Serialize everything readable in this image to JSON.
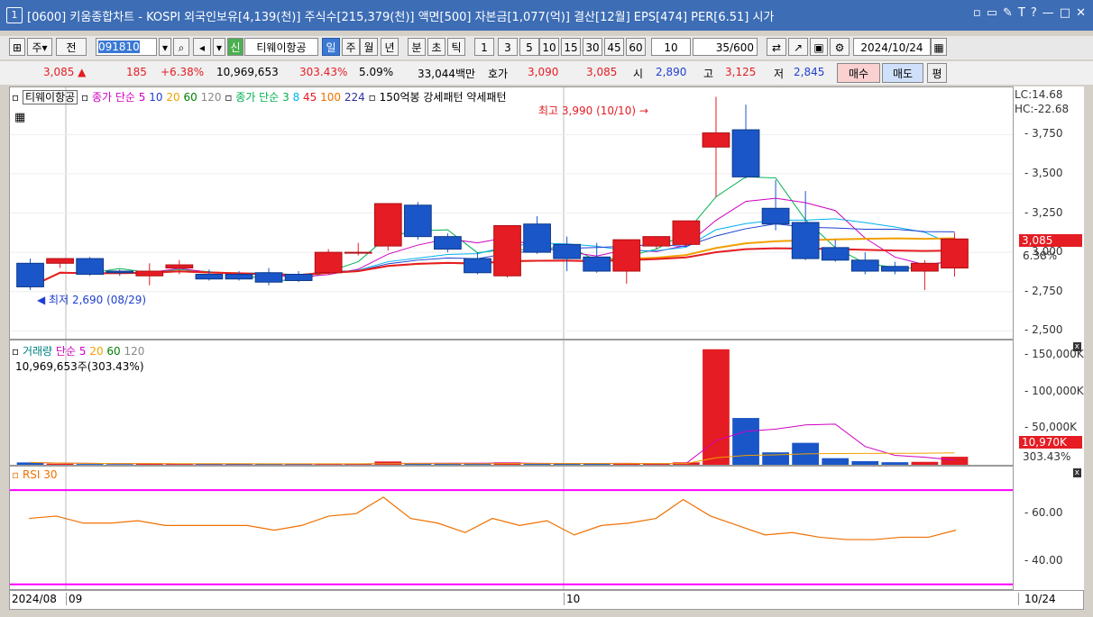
{
  "window": {
    "number": "1",
    "title": "[0600] 키움종합차트 - KOSPI 외국인보유[4,139(천)] 주식수[215,379(천)] 액면[500] 자본금[1,077(억)] 결산[12월] EPS[474] PER[6.51] 시가"
  },
  "toolbar": {
    "period_type": "주",
    "prev_label": "전",
    "code_value": "091810",
    "stock_name": "티웨이항공",
    "new_badge": "신",
    "tabs": [
      "일",
      "주",
      "월",
      "년",
      "분",
      "초",
      "틱"
    ],
    "selected_tab": "일",
    "interval_buttons": [
      "1",
      "3",
      "5",
      "10",
      "15",
      "30",
      "45",
      "60"
    ],
    "interval_value": "10",
    "count_value": "35",
    "count_total": "/600",
    "date_value": "2024/10/24"
  },
  "quote": {
    "price": "3,085",
    "change": "185",
    "change_pct": "+6.38%",
    "volume": "10,969,653",
    "volume_ratio": "303.43%",
    "turnover_pct": "5.09%",
    "amount": "33,044백만",
    "bid_label": "호가",
    "ask_price": "3,090",
    "bid_price": "3,085",
    "open_label": "시",
    "open": "2,890",
    "high_label": "고",
    "high": "3,125",
    "low_label": "저",
    "low": "2,845",
    "buy_label": "매수",
    "sell_label": "매도",
    "eval_label": "평"
  },
  "price_panel": {
    "legend_name": "티웨이항공",
    "legend_ma_label": "종가 단순",
    "legend_ma_periods": [
      "5",
      "10",
      "20",
      "60",
      "120"
    ],
    "legend_ma2_label": "종가 단순",
    "legend_ma2_periods": [
      "3",
      "8",
      "45",
      "100",
      "224"
    ],
    "legend_pattern": "150억봉 강세패턴  약세패턴",
    "lc": "LC:14.68",
    "hc": "HC:-22.68",
    "high_annotation": "최고 3,990 (10/10)",
    "low_annotation": "최저 2,690 (08/29)",
    "current_price_tag": "3,085",
    "current_pct_tag": "6.38%",
    "y_ticks": [
      "3,750",
      "3,500",
      "3,250",
      "3,000",
      "2,750",
      "2,500"
    ]
  },
  "volume_panel": {
    "legend_label": "거래량",
    "legend_ma_label": "단순",
    "legend_ma_periods": [
      "5",
      "20",
      "60",
      "120"
    ],
    "volume_text": "10,969,653주(303.43%)",
    "current_tag": "10,970K",
    "current_pct": "303.43%",
    "y_ticks": [
      "150,000K",
      "100,000K",
      "50,000K"
    ]
  },
  "rsi_panel": {
    "legend_label": "RSI 30",
    "y_ticks": [
      "60.00",
      "40.00"
    ]
  },
  "date_axis": {
    "labels": [
      "2024/08",
      "09",
      "10",
      "10/24"
    ]
  },
  "chart_data": {
    "type": "candlestick",
    "dates_label_start": "2024/08",
    "candles": [
      {
        "o": 2930,
        "h": 2960,
        "c": 2780,
        "l": 2760
      },
      {
        "o": 2930,
        "h": 2950,
        "c": 2960,
        "l": 2900
      },
      {
        "o": 2960,
        "h": 2970,
        "c": 2860,
        "l": 2850
      },
      {
        "o": 2880,
        "h": 2890,
        "c": 2870,
        "l": 2850
      },
      {
        "o": 2850,
        "h": 2930,
        "c": 2880,
        "l": 2790
      },
      {
        "o": 2900,
        "h": 2950,
        "c": 2920,
        "l": 2860
      },
      {
        "o": 2860,
        "h": 2890,
        "c": 2830,
        "l": 2820
      },
      {
        "o": 2860,
        "h": 2880,
        "c": 2830,
        "l": 2820
      },
      {
        "o": 2870,
        "h": 2900,
        "c": 2810,
        "l": 2790
      },
      {
        "o": 2860,
        "h": 2880,
        "c": 2820,
        "l": 2810
      },
      {
        "o": 2870,
        "h": 3020,
        "c": 3000,
        "l": 2860
      },
      {
        "o": 3000,
        "h": 3060,
        "c": 3000,
        "l": 2980
      },
      {
        "o": 3040,
        "h": 3310,
        "c": 3310,
        "l": 3010
      },
      {
        "o": 3300,
        "h": 3320,
        "c": 3100,
        "l": 3080
      },
      {
        "o": 3100,
        "h": 3120,
        "c": 3020,
        "l": 3000
      },
      {
        "o": 2960,
        "h": 3000,
        "c": 2870,
        "l": 2860
      },
      {
        "o": 2850,
        "h": 3050,
        "c": 3170,
        "l": 2840
      },
      {
        "o": 3180,
        "h": 3230,
        "c": 3000,
        "l": 2990
      },
      {
        "o": 3050,
        "h": 3100,
        "c": 2960,
        "l": 2880
      },
      {
        "o": 2970,
        "h": 3060,
        "c": 2880,
        "l": 2870
      },
      {
        "o": 2880,
        "h": 3070,
        "c": 3080,
        "l": 2800
      },
      {
        "o": 3040,
        "h": 3100,
        "c": 3100,
        "l": 3020
      },
      {
        "o": 3050,
        "h": 3190,
        "c": 3200,
        "l": 3040
      },
      {
        "o": 3670,
        "h": 3990,
        "c": 3760,
        "l": 3350
      },
      {
        "o": 3780,
        "h": 3940,
        "c": 3480,
        "l": 3470
      },
      {
        "o": 3280,
        "h": 3460,
        "c": 3180,
        "l": 3140
      },
      {
        "o": 3190,
        "h": 3390,
        "c": 2960,
        "l": 2950
      },
      {
        "o": 3030,
        "h": 3080,
        "c": 2950,
        "l": 2940
      },
      {
        "o": 2950,
        "h": 3000,
        "c": 2880,
        "l": 2860
      },
      {
        "o": 2910,
        "h": 2940,
        "c": 2880,
        "l": 2860
      },
      {
        "o": 2880,
        "h": 2950,
        "c": 2930,
        "l": 2760
      },
      {
        "o": 2900,
        "h": 3125,
        "c": 3085,
        "l": 2845
      }
    ],
    "volumes": [
      3200,
      1500,
      1100,
      900,
      1500,
      1300,
      1200,
      1100,
      1000,
      900,
      1500,
      1000,
      4500,
      2200,
      1500,
      1200,
      3300,
      2100,
      1300,
      1400,
      2000,
      1500,
      3300,
      158000,
      64000,
      17000,
      30000,
      9000,
      5000,
      3500,
      4000,
      10970
    ],
    "rsi": [
      58,
      59,
      56,
      56,
      57,
      55,
      55,
      55,
      55,
      53,
      55,
      59,
      60,
      67,
      58,
      56,
      52,
      58,
      55,
      57,
      51,
      55,
      56,
      58,
      66,
      59,
      55,
      51,
      52,
      50,
      49,
      49,
      50,
      50,
      53
    ],
    "y_range_price": [
      2450,
      4050
    ],
    "y_range_volume": [
      0,
      170000
    ],
    "y_range_rsi": [
      28,
      80
    ]
  }
}
